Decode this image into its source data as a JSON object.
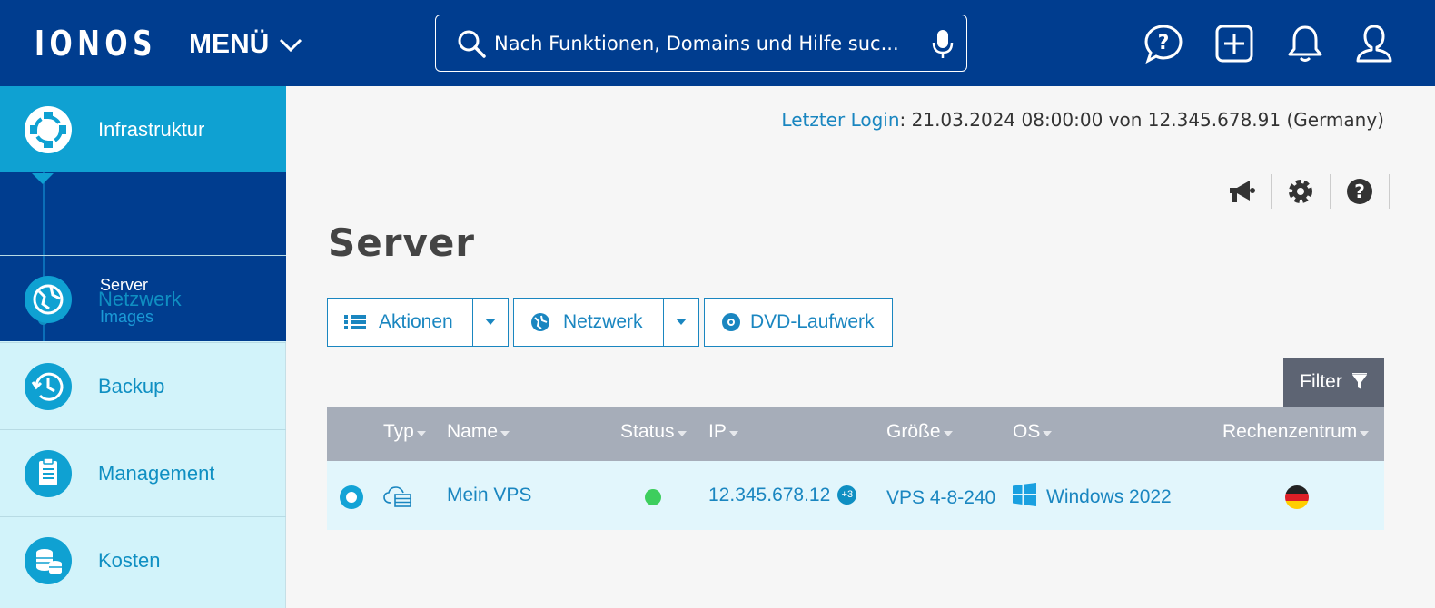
{
  "header": {
    "logo": "IONOS",
    "menu_label": "MENÜ",
    "search_placeholder": "Nach Funktionen, Domains und Hilfe suc...",
    "icons": [
      "help-chat-icon",
      "add-icon",
      "bell-icon",
      "user-icon"
    ]
  },
  "sidebar": {
    "active": {
      "label": "Infrastruktur",
      "icon": "infrastructure-icon"
    },
    "sub_items": [
      {
        "label": "Server",
        "active": true
      },
      {
        "label": "Images",
        "active": false
      }
    ],
    "items": [
      {
        "label": "Netzwerk",
        "icon": "network-globe-icon"
      },
      {
        "label": "Backup",
        "icon": "backup-clock-icon"
      },
      {
        "label": "Management",
        "icon": "clipboard-icon"
      },
      {
        "label": "Kosten",
        "icon": "coins-icon"
      }
    ]
  },
  "main": {
    "last_login": {
      "link": "Letzter Login",
      "text": ": 21.03.2024 08:00:00 von 12.345.678.91 (Germany)"
    },
    "tool_icons": [
      "megaphone-icon",
      "gear-icon",
      "question-icon"
    ],
    "title": "Server",
    "buttons": {
      "aktionen": "Aktionen",
      "netzwerk": "Netzwerk",
      "dvd": "DVD-Laufwerk"
    },
    "filter_label": "Filter",
    "table": {
      "columns": [
        "Typ",
        "Name",
        "Status",
        "IP",
        "Größe",
        "OS",
        "Rechenzentrum"
      ],
      "rows": [
        {
          "type_icon": "cloud-server-icon",
          "name": "Mein VPS",
          "status": "online",
          "status_color": "#3dce5d",
          "ip": "12.345.678.12",
          "ip_extra": "+3",
          "size": "VPS 4-8-240",
          "os": "Windows 2022",
          "os_icon": "windows-icon",
          "datacenter_icon": "germany-flag-icon"
        }
      ]
    }
  },
  "colors": {
    "header_bg": "#003d8f",
    "sidebar_active": "#0fa1d2",
    "sidebar_bg": "#d2f3fa",
    "accent": "#1a86c0",
    "table_header": "#a6adb9",
    "filter_bg": "#5d6473"
  }
}
